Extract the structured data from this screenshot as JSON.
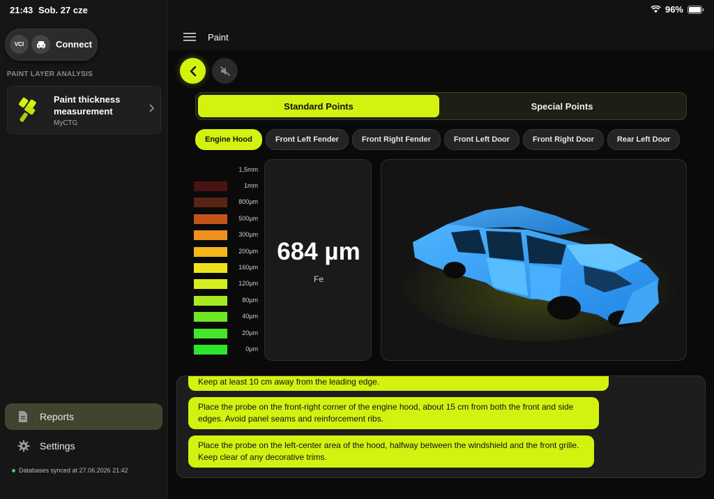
{
  "status": {
    "time": "21:43",
    "date": "Sob. 27 cze",
    "battery": "96%"
  },
  "sidebar": {
    "connect": {
      "vci": "VCI",
      "label": "Connect"
    },
    "section_title": "PAINT LAYER ANALYSIS",
    "card": {
      "title": "Paint thickness measurement",
      "subtitle": "MyCTG"
    },
    "nav": [
      {
        "label": "Reports",
        "icon": "document-icon",
        "active": true
      },
      {
        "label": "Settings",
        "icon": "gear-icon",
        "active": false
      }
    ],
    "sync_text": "Databases synced at 27.06.2026 21:42"
  },
  "header": {
    "title": "Paint"
  },
  "tabs": {
    "active": "Standard Points",
    "inactive": "Special Points"
  },
  "chips": [
    "Engine Hood",
    "Front Left Fender",
    "Front Right Fender",
    "Front Left Door",
    "Front Right Door",
    "Rear Left Door"
  ],
  "scale": {
    "top_label": "1,5mm",
    "rows": [
      {
        "label": "1mm",
        "color": "#4a1212"
      },
      {
        "label": "800µm",
        "color": "#5a2414"
      },
      {
        "label": "500µm",
        "color": "#c2541a"
      },
      {
        "label": "300µm",
        "color": "#f0901c"
      },
      {
        "label": "200µm",
        "color": "#f5b61c"
      },
      {
        "label": "160µm",
        "color": "#f0e21c"
      },
      {
        "label": "120µm",
        "color": "#d7ee1e"
      },
      {
        "label": "80µm",
        "color": "#a8ea22"
      },
      {
        "label": "40µm",
        "color": "#6fe824"
      },
      {
        "label": "20µm",
        "color": "#44e629"
      },
      {
        "label": "0µm",
        "color": "#2ee42c"
      }
    ]
  },
  "reading": {
    "value": "684 µm",
    "material": "Fe"
  },
  "messages": [
    "Keep at least 10 cm away from the leading edge.",
    "Place the probe on the front-right corner of the engine hood, about 15 cm from both the front and side edges. Avoid panel seams and reinforcement ribs.",
    "Place the probe on the left-center area of the hood, halfway between the windshield and the front grille. Keep clear of any decorative trims."
  ],
  "accent_color": "#d4f20f"
}
